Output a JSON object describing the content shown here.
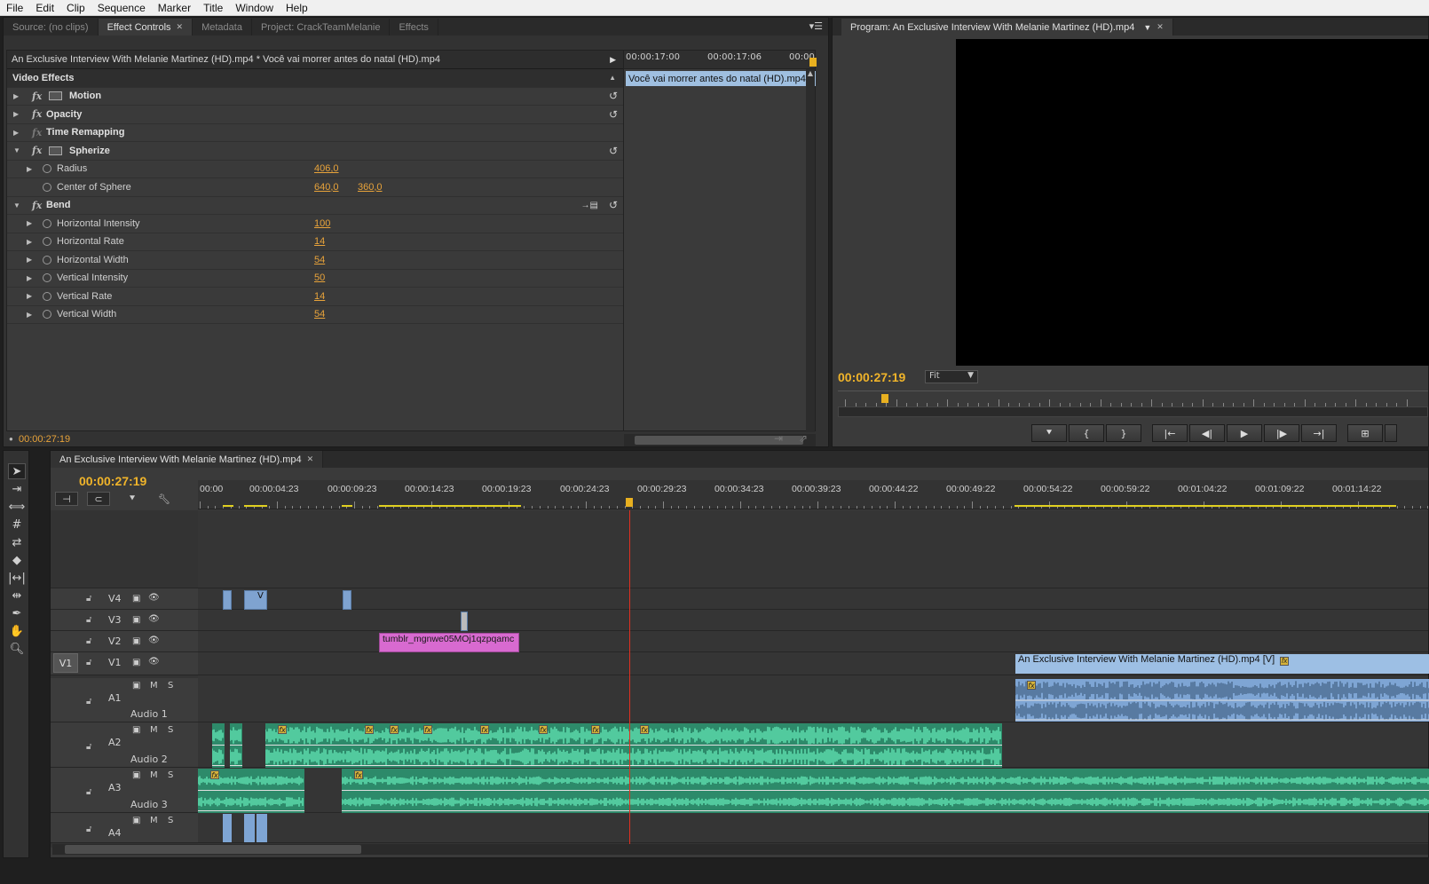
{
  "menu": [
    "File",
    "Edit",
    "Clip",
    "Sequence",
    "Marker",
    "Title",
    "Window",
    "Help"
  ],
  "left_panel": {
    "tabs": [
      {
        "label": "Source: (no clips)",
        "active": false
      },
      {
        "label": "Effect Controls",
        "active": true,
        "closable": true
      },
      {
        "label": "Metadata",
        "active": false
      },
      {
        "label": "Project: CrackTeamMelanie",
        "active": false
      },
      {
        "label": "Effects",
        "active": false
      }
    ],
    "clip_header": "An Exclusive Interview With Melanie Martinez (HD).mp4 * Você vai morrer antes do natal (HD).mp4",
    "section_title": "Video Effects",
    "effects": [
      {
        "name": "Motion",
        "fx": true,
        "film": true,
        "reset": true
      },
      {
        "name": "Opacity",
        "fx": true,
        "film": false,
        "reset": true
      },
      {
        "name": "Time Remapping",
        "fx": true,
        "film": false,
        "reset": false
      },
      {
        "name": "Spherize",
        "fx": true,
        "film": true,
        "reset": true,
        "expanded": true,
        "params": [
          {
            "name": "Radius",
            "value": "406,0",
            "value2": ""
          },
          {
            "name": "Center of Sphere",
            "value": "640,0",
            "value2": "360,0"
          }
        ]
      },
      {
        "name": "Bend",
        "fx": true,
        "film": false,
        "reset": true,
        "expanded": true,
        "params": [
          {
            "name": "Horizontal Intensity",
            "value": "100"
          },
          {
            "name": "Horizontal Rate",
            "value": "14"
          },
          {
            "name": "Horizontal Width",
            "value": "54"
          },
          {
            "name": "Vertical Intensity",
            "value": "50"
          },
          {
            "name": "Vertical Rate",
            "value": "14"
          },
          {
            "name": "Vertical Width",
            "value": "54"
          }
        ]
      }
    ],
    "mini_ruler": [
      "00:00:17:00",
      "00:00:17:06",
      "00:00"
    ],
    "mini_clip": "Você vai morrer antes do natal (HD).mp4",
    "footer_timecode": "00:00:27:19"
  },
  "program": {
    "tab_label": "Program: An Exclusive Interview With Melanie Martinez (HD).mp4",
    "timecode": "00:00:27:19",
    "fit_label": "Fit"
  },
  "timeline": {
    "tab_label": "An Exclusive Interview With Melanie Martinez (HD).mp4",
    "timecode": "00:00:27:19",
    "ruler_labels": [
      "00:00",
      "00:00:04:23",
      "00:00:09:23",
      "00:00:14:23",
      "00:00:19:23",
      "00:00:24:23",
      "00:00:29:23",
      "00:00:34:23",
      "00:00:39:23",
      "00:00:44:22",
      "00:00:49:22",
      "00:00:54:22",
      "00:00:59:22",
      "00:01:04:22",
      "00:01:09:22",
      "00:01:14:22"
    ],
    "video_tracks": [
      "V4",
      "V3",
      "V2",
      "V1"
    ],
    "source_patch": "V1",
    "audio_tracks": [
      {
        "id": "A1",
        "name": "Audio 1"
      },
      {
        "id": "A2",
        "name": "Audio 2"
      },
      {
        "id": "A3",
        "name": "Audio 3"
      },
      {
        "id": "A4",
        "name": ""
      }
    ],
    "clip_v4_label": "V",
    "clip_v2_label": "tumblr_mgnwe05MOj1qzpqamc",
    "clip_v1_label": "An Exclusive Interview With Melanie Martinez (HD).mp4 [V]",
    "mute_label": "M",
    "solo_label": "S",
    "fx_label": "fx"
  }
}
